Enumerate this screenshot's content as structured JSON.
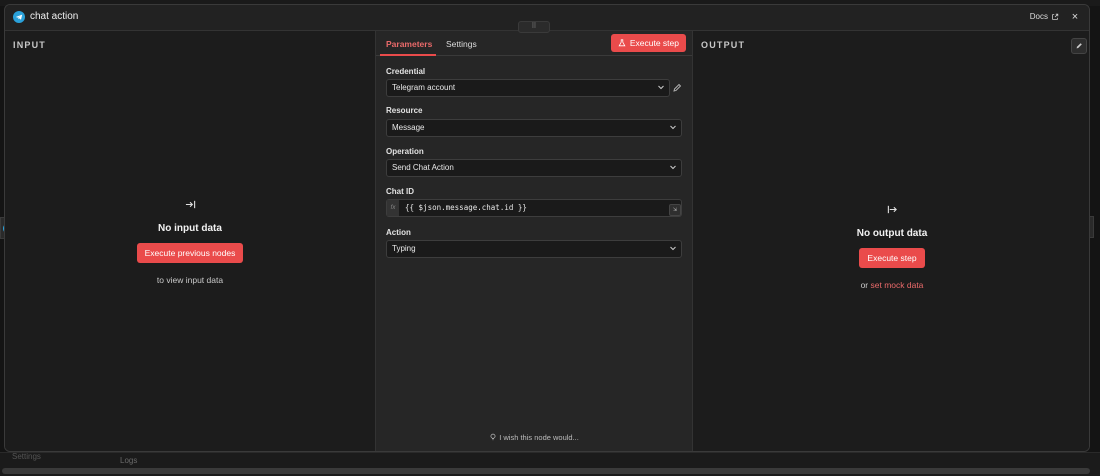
{
  "background": {
    "settings_label": "Settings",
    "logs_label": "Logs"
  },
  "header": {
    "title": "chat action",
    "docs_label": "Docs",
    "close_symbol": "×",
    "node_icon": "telegram-icon"
  },
  "input_panel": {
    "label": "INPUT",
    "empty_title": "No input data",
    "button_label": "Execute previous nodes",
    "hint": "to view input data",
    "icon": "arrow-to-right-icon"
  },
  "params_panel": {
    "tabs": [
      {
        "label": "Parameters",
        "active": true
      },
      {
        "label": "Settings",
        "active": false
      }
    ],
    "execute_label": "Execute step",
    "fields": {
      "credential": {
        "label": "Credential",
        "value": "Telegram account"
      },
      "resource": {
        "label": "Resource",
        "value": "Message"
      },
      "operation": {
        "label": "Operation",
        "value": "Send Chat Action"
      },
      "chat_id": {
        "label": "Chat ID",
        "value": "{{ $json.message.chat.id }}",
        "fx_label": "fx"
      },
      "action": {
        "label": "Action",
        "value": "Typing"
      }
    },
    "wish_text": "I wish this node would..."
  },
  "output_panel": {
    "label": "OUTPUT",
    "empty_title": "No output data",
    "button_label": "Execute step",
    "hint_prefix": "or",
    "hint_link": "set mock data",
    "icon": "arrow-right-icon"
  },
  "colors": {
    "accent": "#ea4b4b",
    "telegram": "#2aa1da",
    "panel_bg": "#1c1c1c",
    "params_bg": "#262626"
  }
}
